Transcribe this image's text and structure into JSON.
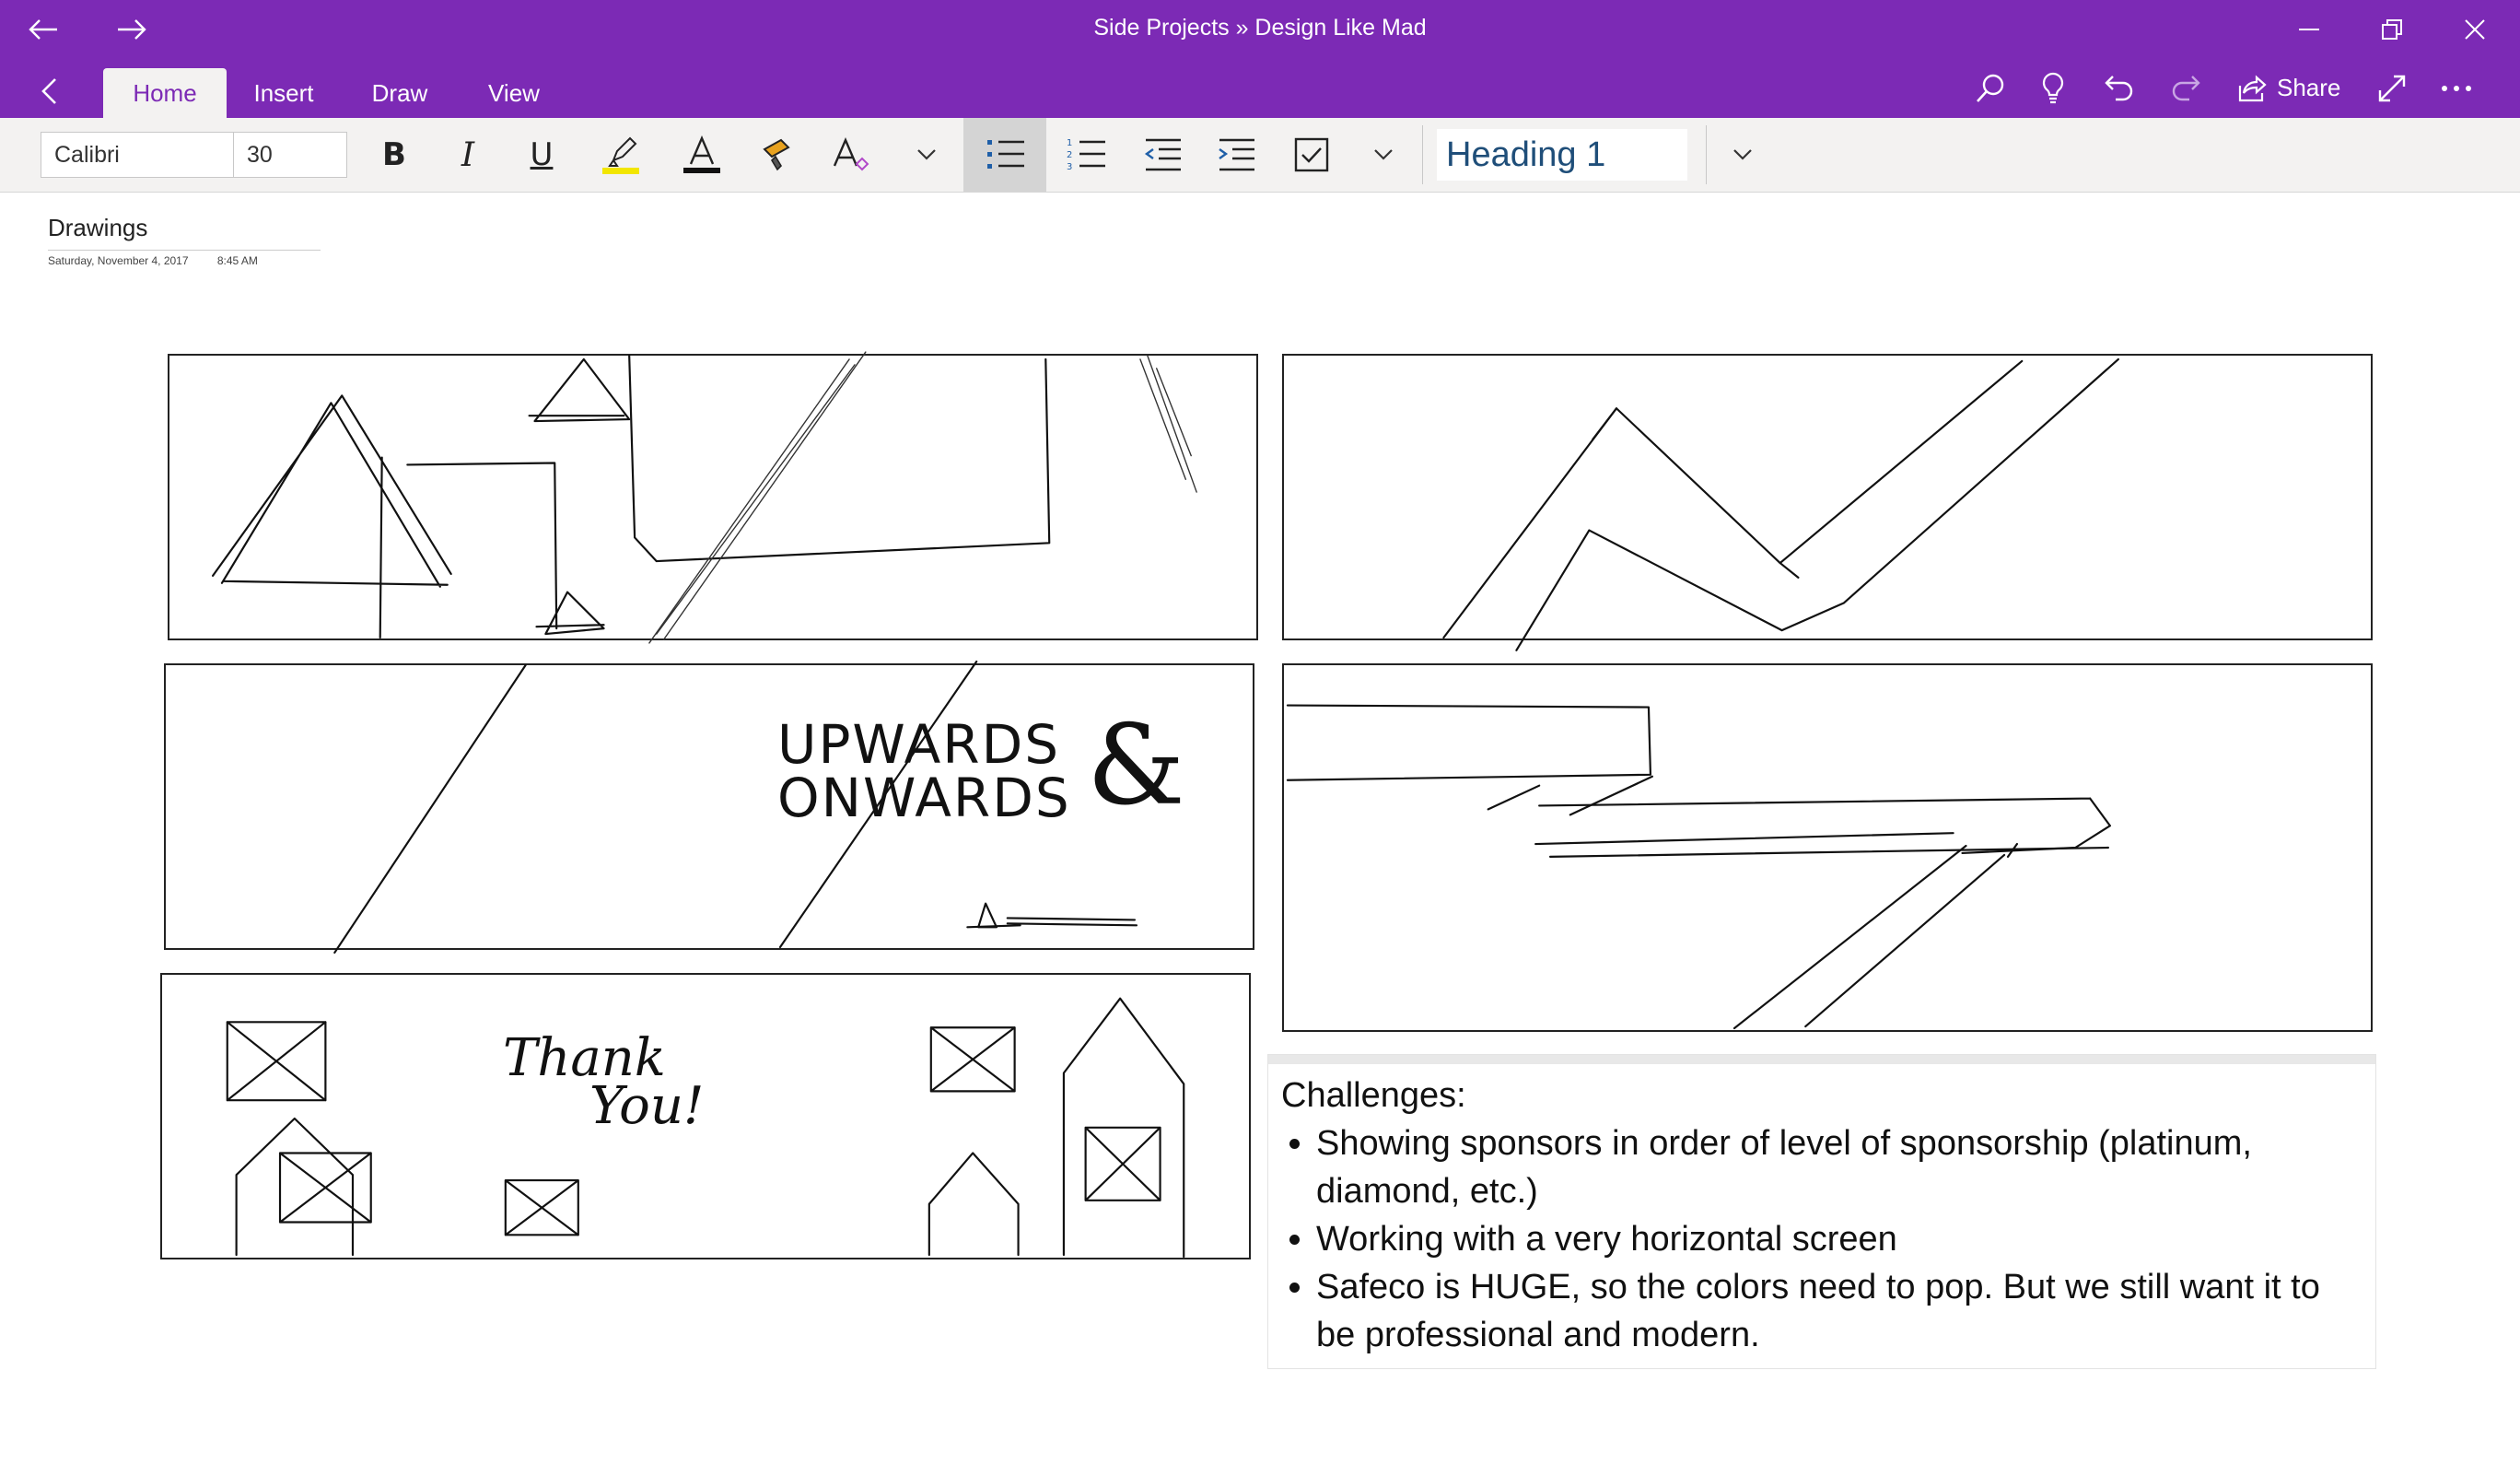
{
  "window": {
    "title": "Side Projects » Design Like Mad"
  },
  "tabs": [
    {
      "label": "Home",
      "active": true
    },
    {
      "label": "Insert",
      "active": false
    },
    {
      "label": "Draw",
      "active": false
    },
    {
      "label": "View",
      "active": false
    }
  ],
  "toolbar": {
    "share_label": "Share"
  },
  "ribbon": {
    "font_name": "Calibri",
    "font_size": "30",
    "style": "Heading 1",
    "highlight_color": "#f2e600",
    "font_color": "#111111"
  },
  "page": {
    "title": "Drawings",
    "date": "Saturday, November 4, 2017",
    "time": "8:45 AM"
  },
  "sketches": {
    "upwards_line1": "UPWARDS",
    "upwards_line2": "ONWARDS",
    "ampersand": "&",
    "thank_line1": "Thank",
    "thank_line2": "You!"
  },
  "note": {
    "heading": "Challenges:",
    "bullets": [
      "Showing sponsors in order of level of sponsorship (platinum, diamond, etc.)",
      "Working with a very horizontal screen",
      "Safeco is HUGE, so the colors need to pop. But we still want it to be professional and modern."
    ]
  },
  "colors": {
    "accent": "#7c2ab5",
    "ribbon_bg": "#f3f2f1",
    "heading_text": "#1f4e79"
  }
}
